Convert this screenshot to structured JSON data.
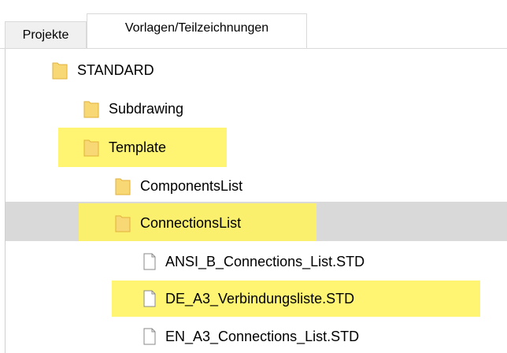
{
  "tabs": [
    {
      "label": "Projekte",
      "active": false
    },
    {
      "label": "Vorlagen/Teilzeichnungen",
      "active": true
    }
  ],
  "tree": {
    "nodes": [
      {
        "label": "STANDARD",
        "type": "folder",
        "depth": 0
      },
      {
        "label": "Subdrawing",
        "type": "folder",
        "depth": 1
      },
      {
        "label": "Template",
        "type": "folder",
        "depth": 1,
        "highlighted": true
      },
      {
        "label": "ComponentsList",
        "type": "folder",
        "depth": 2
      },
      {
        "label": "ConnectionsList",
        "type": "folder",
        "depth": 2,
        "highlighted": true,
        "selected": true
      },
      {
        "label": "ANSI_B_Connections_List.STD",
        "type": "file",
        "depth": 3
      },
      {
        "label": "DE_A3_Verbindungsliste.STD",
        "type": "file",
        "depth": 3,
        "highlighted": true
      },
      {
        "label": "EN_A3_Connections_List.STD",
        "type": "file",
        "depth": 3
      }
    ]
  },
  "colors": {
    "highlight": "#fff35a",
    "selection": "#d9d9d9",
    "folder": "#f8d775"
  }
}
